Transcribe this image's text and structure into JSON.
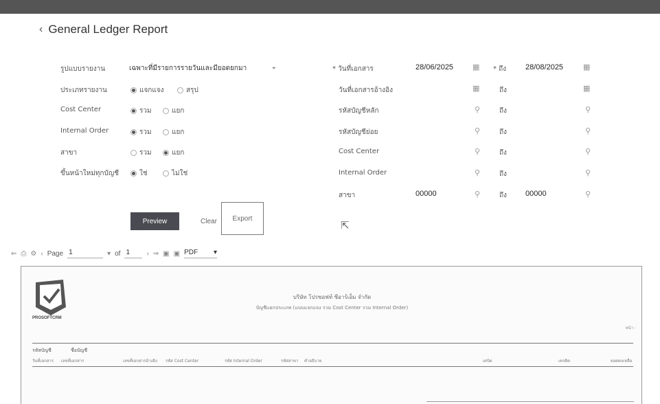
{
  "header": {
    "back_icon": "chevron-left-icon",
    "title": "General Ledger Report"
  },
  "form_left": {
    "report_format": {
      "label": "รูปแบบรายงาน",
      "value": "เฉพาะที่มีรายการรายวันและมียอดยกมา"
    },
    "report_type": {
      "label": "ประเภทรายงาน",
      "options": [
        "แจกแจง",
        "สรุป"
      ],
      "selected": "แจกแจง"
    },
    "cost_center": {
      "label": "Cost Center",
      "options": [
        "รวม",
        "แยก"
      ],
      "selected": "รวม"
    },
    "internal_order": {
      "label": "Internal Order",
      "options": [
        "รวม",
        "แยก"
      ],
      "selected": "รวม"
    },
    "branch": {
      "label": "สาขา",
      "options": [
        "รวม",
        "แยก"
      ],
      "selected": "แยก"
    },
    "new_page": {
      "label": "ขึ้นหน้าใหม่ทุกบัญชี",
      "options": [
        "ใช่",
        "ไม่ใช่"
      ],
      "selected": "ใช่"
    }
  },
  "form_right": {
    "to_label": "ถึง",
    "doc_date": {
      "label": "* วันที่เอกสาร",
      "from": "28/06/2025",
      "to_label": "* ถึง",
      "to": "28/08/2025"
    },
    "ref_doc_date": {
      "label": "วันที่เอกสารอ้างอิง",
      "from": "",
      "to": ""
    },
    "main_account": {
      "label": "รหัสบัญชีหลัก",
      "from": "",
      "to": ""
    },
    "sub_account": {
      "label": "รหัสบัญชีย่อย",
      "from": "",
      "to": ""
    },
    "cost_center": {
      "label": "Cost Center",
      "from": "",
      "to": ""
    },
    "internal_order": {
      "label": "Internal Order",
      "from": "",
      "to": ""
    },
    "branch": {
      "label": "สาขา",
      "from": "00000",
      "to": "00000"
    }
  },
  "actions": {
    "preview": "Preview",
    "clear": "Clear",
    "export": "Export"
  },
  "viewer": {
    "page_label": "Page",
    "page_value": "1",
    "of_label": "of",
    "total_pages": "1",
    "format": "PDF"
  },
  "report": {
    "logo_text": "PROSOFTCRM",
    "company": "บริษัท โปรซอฟท์ ซีอาร์เอ็ม จำกัด",
    "subtitle": "บัญชีแยกประเภท (แบบแจกแจง รวม Cost Center รวม Internal Order)",
    "page_text": "หน้า :",
    "col_account_code": "รหัสบัญชี",
    "col_account_name": "ชื่อบัญชี",
    "col_date": "วันที่เอกสาร",
    "col_doc_no": "เลขที่เอกสาร",
    "col_ref_no": "เลขที่เอกสารอ้างอิง",
    "col_cost_center": "รหัส Cost Center",
    "col_internal_order": "รหัส Internal Order",
    "col_branch": "รหัสสาขา",
    "col_desc": "คำอธิบาย",
    "col_debit": "เดบิต",
    "col_credit": "เครดิต",
    "col_balance": "ยอดคงเหลือ"
  }
}
